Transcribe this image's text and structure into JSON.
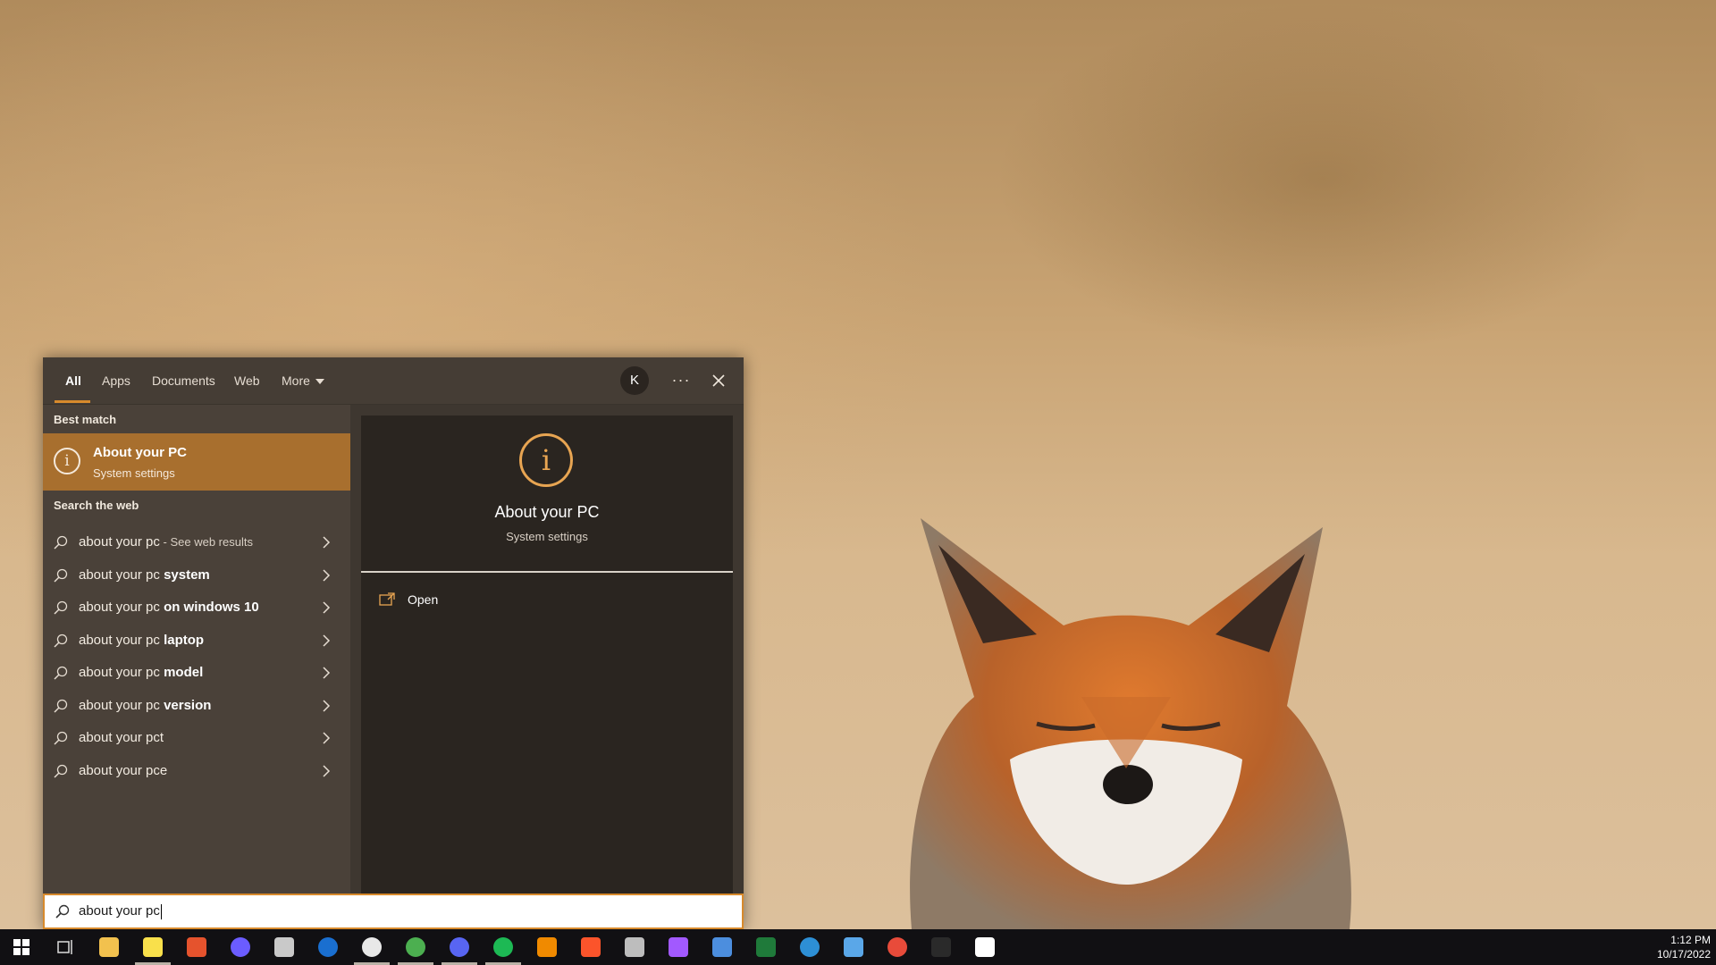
{
  "search": {
    "tabs": [
      {
        "label": "All",
        "active": true
      },
      {
        "label": "Apps"
      },
      {
        "label": "Documents"
      },
      {
        "label": "Web"
      },
      {
        "label": "More"
      }
    ],
    "avatar_initial": "K",
    "more_options": "···",
    "best_match_heading": "Best match",
    "best_match": {
      "title": "About your PC",
      "subtitle": "System settings",
      "icon": "info-icon"
    },
    "web_heading": "Search the web",
    "web_results": [
      {
        "prefix": "about your pc",
        "bold": "",
        "suffix": " - See web results"
      },
      {
        "prefix": "about your pc ",
        "bold": "system",
        "suffix": ""
      },
      {
        "prefix": "about your pc ",
        "bold": "on windows 10",
        "suffix": ""
      },
      {
        "prefix": "about your pc ",
        "bold": "laptop",
        "suffix": ""
      },
      {
        "prefix": "about your pc ",
        "bold": "model",
        "suffix": ""
      },
      {
        "prefix": "about your pc ",
        "bold": "version",
        "suffix": ""
      },
      {
        "prefix": "about your pct",
        "bold": "",
        "suffix": ""
      },
      {
        "prefix": "about your pce",
        "bold": "",
        "suffix": ""
      }
    ],
    "preview": {
      "title": "About your PC",
      "subtitle": "System settings",
      "action": "Open"
    },
    "query": "about your pc"
  },
  "taskbar": {
    "items": [
      {
        "name": "start-button",
        "icon": "windows-icon",
        "color": "#ffffff"
      },
      {
        "name": "task-view-button",
        "icon": "task-view-icon",
        "color": "#cfcfcf"
      },
      {
        "name": "file-explorer-button",
        "icon": "folder-icon",
        "color": "#f2c14e"
      },
      {
        "name": "sticky-notes-button",
        "icon": "sticky-note-icon",
        "color": "#f9e04b",
        "open": true
      },
      {
        "name": "app-red-button",
        "icon": "red-app-icon",
        "color": "#e5532d"
      },
      {
        "name": "app-purple-button",
        "icon": "purple-app-icon",
        "color": "#6b5cff"
      },
      {
        "name": "app-cloud-button",
        "icon": "cloud-app-icon",
        "color": "#c9c9c9"
      },
      {
        "name": "password-manager-button",
        "icon": "password-manager-icon",
        "color": "#1a6fd0"
      },
      {
        "name": "slack-button",
        "icon": "slack-icon",
        "color": "#e8e8e8",
        "open": true
      },
      {
        "name": "chrome-button",
        "icon": "chrome-icon",
        "color": "#4caf50",
        "open": true
      },
      {
        "name": "discord-button",
        "icon": "discord-icon",
        "color": "#5865f2",
        "open": true
      },
      {
        "name": "spotify-button",
        "icon": "spotify-icon",
        "color": "#1db954",
        "open": true
      },
      {
        "name": "vlc-button",
        "icon": "vlc-icon",
        "color": "#f08a00"
      },
      {
        "name": "brave-button",
        "icon": "brave-icon",
        "color": "#fb542b"
      },
      {
        "name": "app-pen-button",
        "icon": "pen-app-icon",
        "color": "#bdbdbd"
      },
      {
        "name": "figma-button",
        "icon": "figma-icon",
        "color": "#a259ff"
      },
      {
        "name": "app-grid-button",
        "icon": "grid-app-icon",
        "color": "#4c8ede"
      },
      {
        "name": "app-green-button",
        "icon": "green-app-icon",
        "color": "#1f7a3a"
      },
      {
        "name": "app-mu-button",
        "icon": "mu-app-icon",
        "color": "#2d8fd5"
      },
      {
        "name": "app-dots-button",
        "icon": "dots-app-icon",
        "color": "#5aa7e8"
      },
      {
        "name": "app-ring-button",
        "icon": "ring-app-icon",
        "color": "#e84b3a"
      },
      {
        "name": "live-button",
        "icon": "live-icon",
        "color": "#2a2a2a"
      },
      {
        "name": "app-l-button",
        "icon": "l-app-icon",
        "color": "#ffffff"
      }
    ],
    "clock": {
      "time": "1:12 PM",
      "date": "10/17/2022"
    }
  },
  "colors": {
    "accent": "#d88a2c",
    "best_match_bg": "#a86f2e",
    "panel_bg": "#3e3730"
  }
}
